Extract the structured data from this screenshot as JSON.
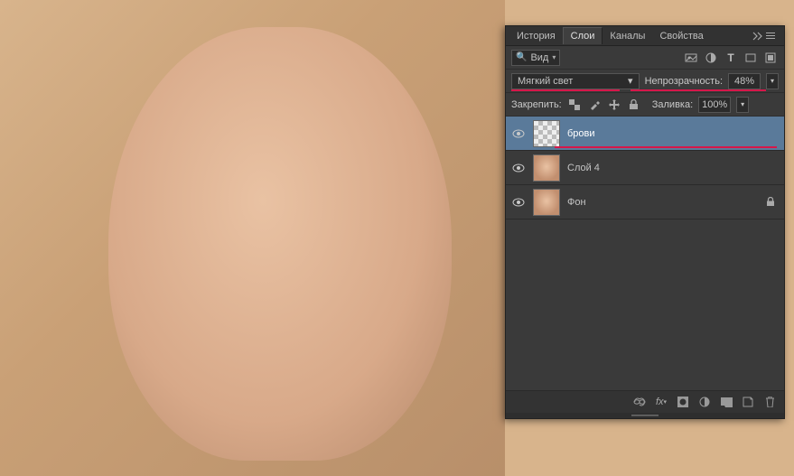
{
  "tabs": {
    "history": "История",
    "layers": "Слои",
    "channels": "Каналы",
    "properties": "Свойства"
  },
  "filter": {
    "kind_label": "Вид"
  },
  "blend": {
    "mode": "Мягкий свет",
    "opacity_label": "Непрозрачность:",
    "opacity_value": "48%"
  },
  "lock": {
    "label": "Закрепить:",
    "fill_label": "Заливка:",
    "fill_value": "100%"
  },
  "layers": [
    {
      "name": "брови",
      "selected": true,
      "thumb": "transparent",
      "locked": false,
      "underline": true
    },
    {
      "name": "Слой 4",
      "selected": false,
      "thumb": "photo",
      "locked": false,
      "underline": false
    },
    {
      "name": "Фон",
      "selected": false,
      "thumb": "photo",
      "locked": true,
      "underline": false
    }
  ]
}
